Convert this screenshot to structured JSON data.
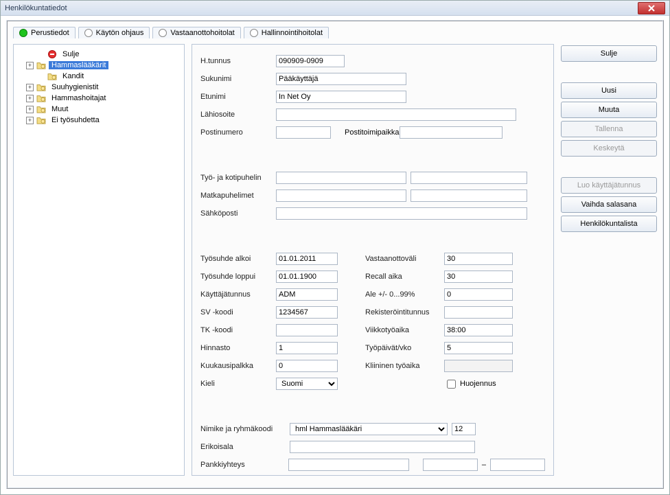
{
  "window_title": "Henkilökuntatiedot",
  "tabs": [
    {
      "label": "Perustiedot",
      "active": true
    },
    {
      "label": "Käytön ohjaus",
      "active": false
    },
    {
      "label": "Vastaanottohoitolat",
      "active": false
    },
    {
      "label": "Hallinnointihoitolat",
      "active": false
    }
  ],
  "tree": [
    {
      "label": "Sulje",
      "expand": "none",
      "icon": "forbid",
      "selected": false
    },
    {
      "label": "Hammaslääkärit",
      "expand": "plus",
      "icon": "folder",
      "selected": true
    },
    {
      "label": "Kandit",
      "expand": "none",
      "icon": "folder",
      "selected": false
    },
    {
      "label": "Suuhygienistit",
      "expand": "plus",
      "icon": "folder",
      "selected": false
    },
    {
      "label": "Hammashoitajat",
      "expand": "plus",
      "icon": "folder",
      "selected": false
    },
    {
      "label": "Muut",
      "expand": "plus",
      "icon": "folder",
      "selected": false
    },
    {
      "label": "Ei työsuhdetta",
      "expand": "plus",
      "icon": "folder",
      "selected": false
    }
  ],
  "fields": {
    "htunnus": {
      "label": "H.tunnus",
      "value": "090909-0909"
    },
    "sukunimi": {
      "label": "Sukunimi",
      "value": "Pääkäyttäjä"
    },
    "etunimi": {
      "label": "Etunimi",
      "value": "In Net Oy"
    },
    "lahiosoite": {
      "label": "Lähiosoite",
      "value": ""
    },
    "postinumero": {
      "label": "Postinumero",
      "value": ""
    },
    "postitoimipaikka": {
      "label": "Postitoimipaikka",
      "value": ""
    },
    "tyopuh": {
      "label": "Työ- ja kotipuhelin",
      "value1": "",
      "value2": ""
    },
    "matka": {
      "label": "Matkapuhelimet",
      "value1": "",
      "value2": ""
    },
    "email": {
      "label": "Sähköposti",
      "value": ""
    },
    "ts_alkoi": {
      "label": "Työsuhde alkoi",
      "value": "01.01.2011"
    },
    "ts_loppui": {
      "label": "Työsuhde loppui",
      "value": "01.01.1900"
    },
    "kayttajatunnus": {
      "label": "Käyttäjätunnus",
      "value": "ADM"
    },
    "svkoodi": {
      "label": "SV -koodi",
      "value": "1234567"
    },
    "tkkoodi": {
      "label": "TK -koodi",
      "value": ""
    },
    "hinnasto": {
      "label": "Hinnasto",
      "value": "1"
    },
    "kkpalkka": {
      "label": "Kuukausipalkka",
      "value": "0"
    },
    "kieli": {
      "label": "Kieli",
      "value": "Suomi"
    },
    "vastaanottovali": {
      "label": "Vastaanottoväli",
      "value": "30"
    },
    "recall": {
      "label": "Recall aika",
      "value": "30"
    },
    "ale": {
      "label": "Ale +/- 0...99%",
      "value": "0"
    },
    "rekisterointi": {
      "label": "Rekisteröintitunnus",
      "value": ""
    },
    "viikkotyo": {
      "label": "Viikkotyöaika",
      "value": "38:00"
    },
    "tyopaivat": {
      "label": "Työpäivät/vko",
      "value": "5"
    },
    "kliininen": {
      "label": "Kliininen työaika",
      "value": ""
    },
    "huojennus": {
      "label": "Huojennus",
      "checked": false
    },
    "nimike": {
      "label": "Nimike ja ryhmäkoodi",
      "value": "hml           Hammaslääkäri",
      "code": "12"
    },
    "erikoisala": {
      "label": "Erikoisala",
      "value": ""
    },
    "pankki": {
      "label": "Pankkiyhteys",
      "value1": "",
      "value2": "",
      "dash": "–",
      "value3": ""
    }
  },
  "buttons": {
    "sulje": "Sulje",
    "uusi": "Uusi",
    "muuta": "Muuta",
    "tallenna": "Tallenna",
    "keskeyta": "Keskeytä",
    "luokt": "Luo käyttäjätunnus",
    "vaihdasalasana": "Vaihda salasana",
    "hkl": "Henkilökuntalista"
  }
}
